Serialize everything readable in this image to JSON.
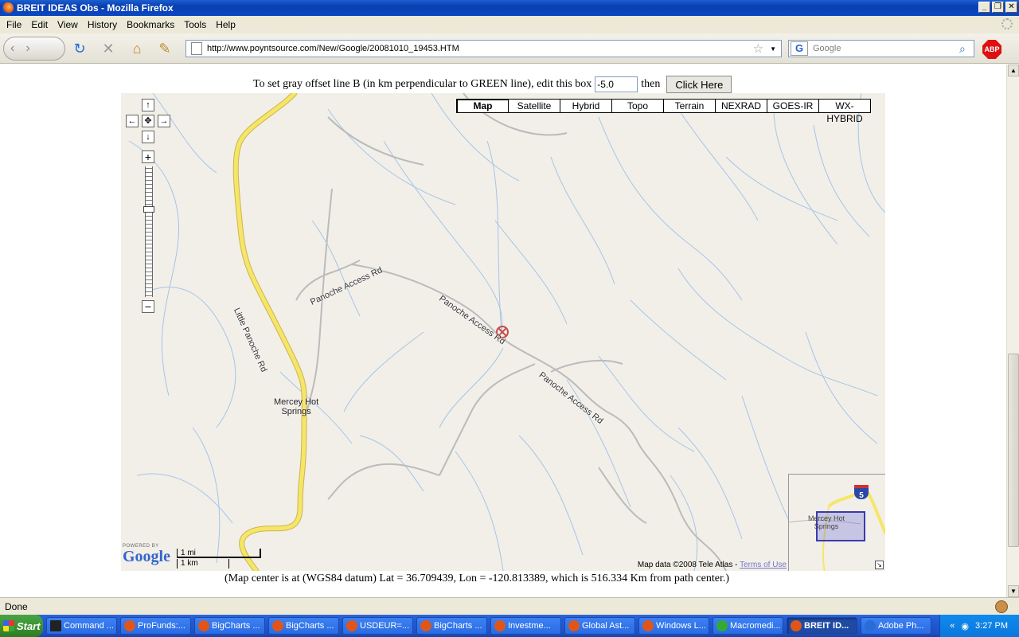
{
  "window": {
    "title": "BREIT IDEAS Obs - Mozilla Firefox"
  },
  "menu": [
    "File",
    "Edit",
    "View",
    "History",
    "Bookmarks",
    "Tools",
    "Help"
  ],
  "nav": {
    "url": "http://www.poyntsource.com/New/Google/20081010_19453.HTM",
    "search_engine": "G",
    "search_placeholder": "Google",
    "adblock_label": "ABP"
  },
  "page": {
    "offset_prefix": "To set gray offset line B (in km perpendicular to GREEN line), edit this box",
    "offset_value": "-5.0",
    "offset_then": "then",
    "click_here": "Click Here",
    "center_text": "(Map center is at (WGS84 datum) Lat = 36.709439, Lon = -120.813389, which is 516.334 Km from path center.)"
  },
  "map": {
    "types": [
      "Map",
      "Satellite",
      "Hybrid",
      "Topo",
      "Terrain",
      "NEXRAD",
      "GOES-IR",
      "WX-HYBRID"
    ],
    "active_type": "Map",
    "labels": {
      "little_panoche": "Little Panoche Rd",
      "panoche_access_1": "Panoche Access Rd",
      "panoche_access_2": "Panoche Access Rd",
      "panoche_access_3": "Panoche Access Rd",
      "town_line1": "Mercey Hot",
      "town_line2": "Springs"
    },
    "copyright": "Map data ©2008 Tele Atlas -",
    "terms": "Terms of Use",
    "powered_by": "POWERED BY",
    "google": "Google",
    "scale_mi": "1 mi",
    "scale_km": "1 km",
    "overview_label_1": "Mercey Hot",
    "overview_label_2": "Springs",
    "overview_shield": "5"
  },
  "status": {
    "text": "Done"
  },
  "taskbar": {
    "start": "Start",
    "items": [
      "Command ...",
      "ProFunds:...",
      "BigCharts ...",
      "BigCharts ...",
      "USDEUR=...",
      "BigCharts ...",
      "Investme...",
      "Global Ast...",
      "Windows L...",
      "Macromedi...",
      "BREIT ID...",
      "Adobe Ph..."
    ],
    "clock": "3:27 PM"
  },
  "colors": {
    "road_yellow": "#f5e66a",
    "map_bg": "#f2efe9",
    "water": "#a6c4e6",
    "taskbar_blue": "#245edb"
  }
}
